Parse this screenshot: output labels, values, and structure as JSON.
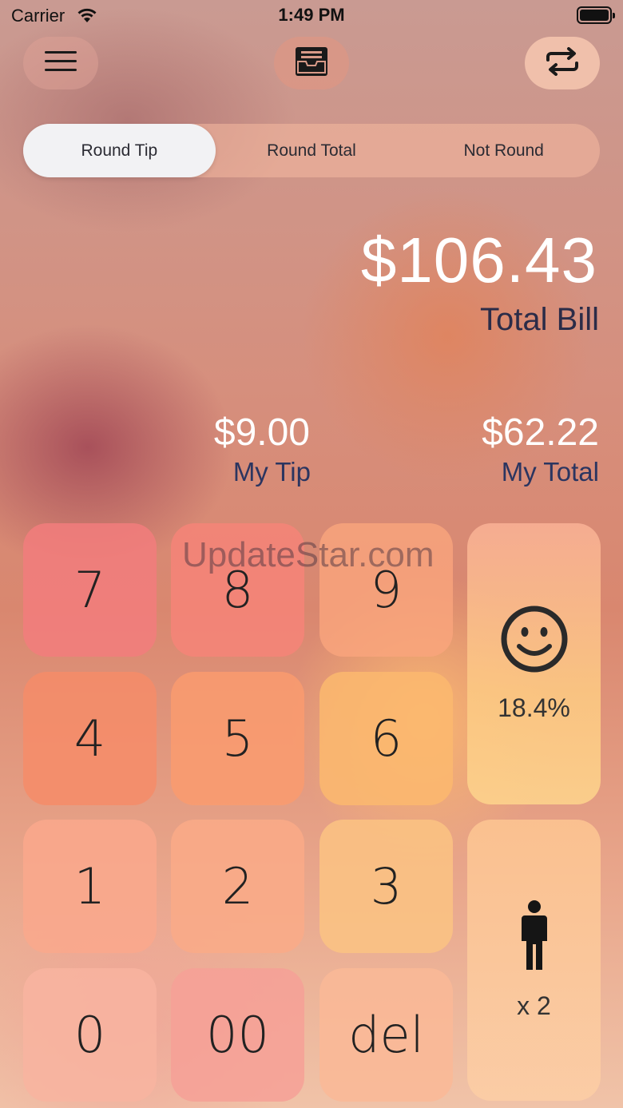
{
  "status_bar": {
    "carrier": "Carrier",
    "time": "1:49 PM"
  },
  "segmented": {
    "options": [
      "Round Tip",
      "Round Total",
      "Not Round"
    ],
    "selected": "Round Tip"
  },
  "bill": {
    "amount": "$106.43",
    "label": "Total Bill"
  },
  "tip": {
    "amount": "$9.00",
    "label": "My Tip"
  },
  "my_total": {
    "amount": "$62.22",
    "label": "My Total"
  },
  "keypad": {
    "keys": [
      "7",
      "8",
      "9",
      "4",
      "5",
      "6",
      "1",
      "2",
      "3",
      "0",
      "00",
      "del"
    ],
    "tip_percent": "18.4%",
    "people": "x 2"
  },
  "watermark": "UpdateStar.com",
  "colors": {
    "key_pink": "#f28a82",
    "key_orange": "#f7a07a",
    "key_yellow": "#fbc27a",
    "key_peach": "#f6b79c",
    "text_dark": "#2b3560"
  },
  "icons": [
    "wifi-icon",
    "battery-icon",
    "menu-icon",
    "inbox-icon",
    "swap-icon",
    "smiley-icon",
    "person-icon"
  ]
}
